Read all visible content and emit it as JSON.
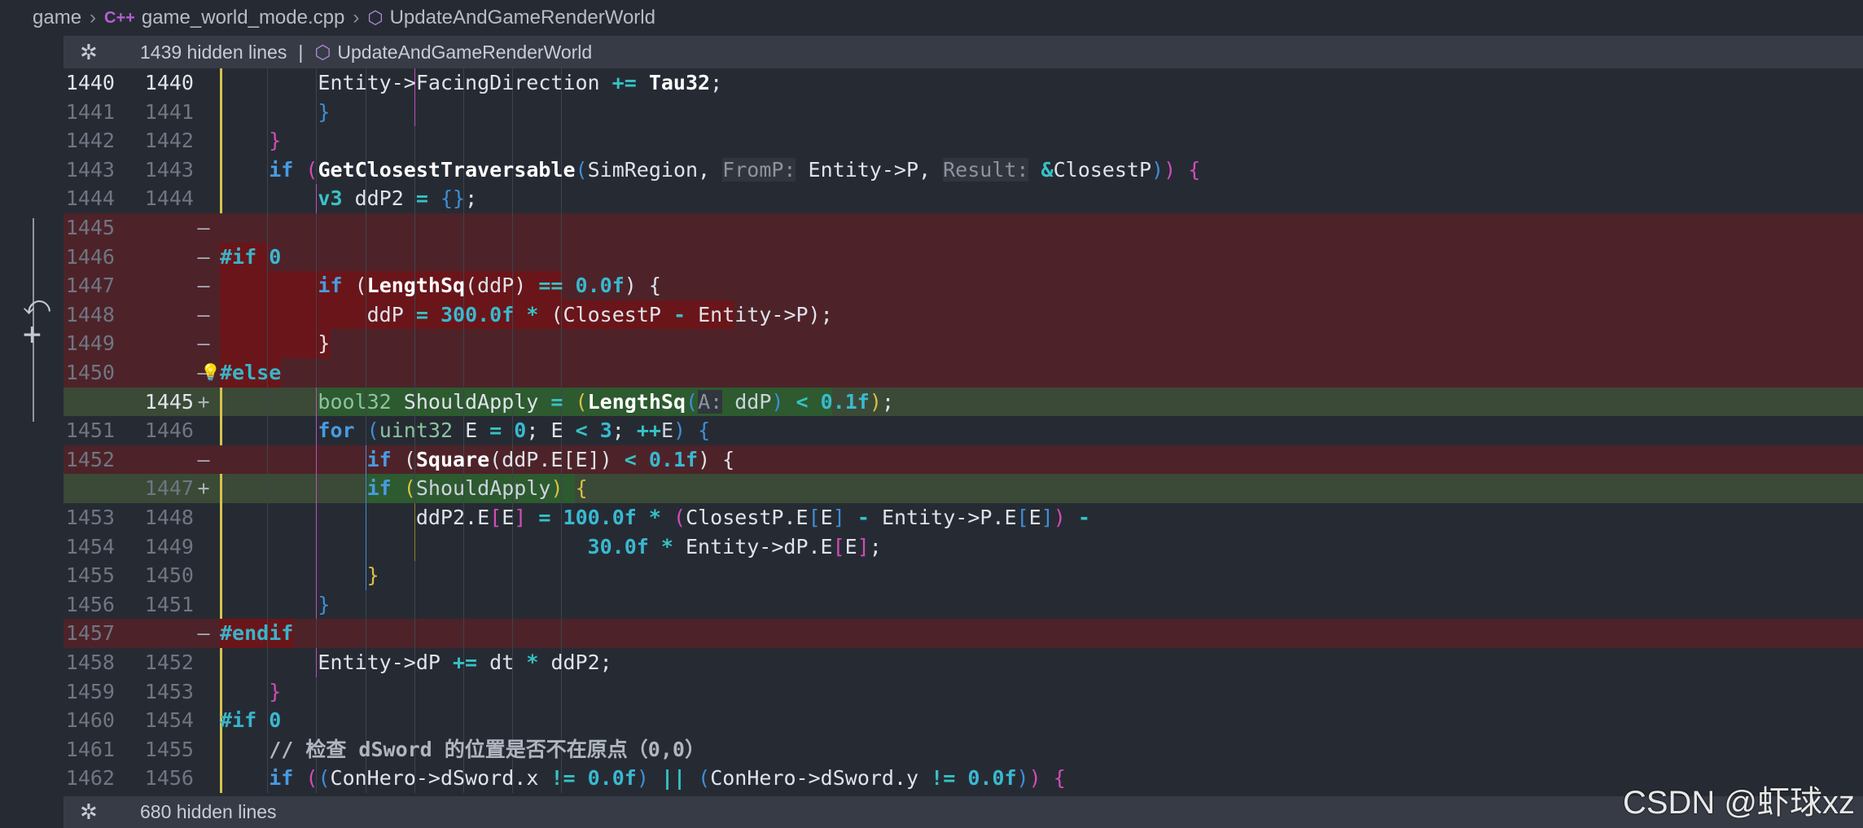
{
  "breadcrumb": {
    "root": "game",
    "file_icon": "C++",
    "file": "game_world_mode.cpp",
    "symbol": "UpdateAndGameRenderWorld"
  },
  "top_fold": {
    "hidden": "1439 hidden lines",
    "separator": "|",
    "symbol": "UpdateAndGameRenderWorld"
  },
  "bottom_fold": {
    "hidden": "680 hidden lines"
  },
  "watermark": "CSDN @虾球xz",
  "colors": {
    "deleted_bg": "#4d2329",
    "deleted_highlight": "#6a1519",
    "inserted_bg": "#3a4a36",
    "inserted_highlight": "#2d5a2f",
    "modified_gutter": "#d7c34a"
  },
  "lines": [
    {
      "old": "1440",
      "new": "1440",
      "type": "ctx",
      "current": true,
      "guides": [
        {
          "c": 2,
          "k": "m"
        },
        {
          "c": 3,
          "k": "g"
        }
      ],
      "tokens": [
        [
          "        ",
          ""
        ],
        [
          "Entity->FacingDirection ",
          "txt"
        ],
        [
          "+=",
          "op"
        ],
        [
          " ",
          ""
        ],
        [
          "Tau32",
          "fn"
        ],
        [
          ";",
          "txt"
        ]
      ]
    },
    {
      "old": "1441",
      "new": "1441",
      "type": "ctx",
      "guides": [
        {
          "c": 2,
          "k": "m"
        }
      ],
      "tokens": [
        [
          "        ",
          ""
        ],
        [
          "}",
          "p2"
        ]
      ]
    },
    {
      "old": "1442",
      "new": "1442",
      "type": "ctx",
      "guides": [],
      "tokens": [
        [
          "    ",
          ""
        ],
        [
          "}",
          "p1"
        ]
      ]
    },
    {
      "old": "1443",
      "new": "1443",
      "type": "ctx",
      "guides": [],
      "tokens": [
        [
          "    ",
          ""
        ],
        [
          "if",
          "kw"
        ],
        [
          " ",
          ""
        ],
        [
          "(",
          "p1"
        ],
        [
          "GetClosestTraversable",
          "fn"
        ],
        [
          "(",
          "p2"
        ],
        [
          "SimRegion, ",
          "txt"
        ],
        [
          "FromP:",
          "hint"
        ],
        [
          " Entity->P, ",
          "txt"
        ],
        [
          "Result:",
          "hint"
        ],
        [
          " ",
          ""
        ],
        [
          "&",
          "op"
        ],
        [
          "ClosestP",
          "txt"
        ],
        [
          ")",
          "p2"
        ],
        [
          ")",
          "p1"
        ],
        [
          " ",
          ""
        ],
        [
          "{",
          "p1"
        ]
      ]
    },
    {
      "old": "1444",
      "new": "1444",
      "type": "ctx",
      "guides": [
        {
          "c": 0,
          "k": "m"
        }
      ],
      "tokens": [
        [
          "        ",
          ""
        ],
        [
          "v3",
          "kt"
        ],
        [
          " ddP2 ",
          "txt"
        ],
        [
          "=",
          "op"
        ],
        [
          " ",
          ""
        ],
        [
          "{}",
          "p2"
        ],
        [
          ";",
          "txt"
        ]
      ]
    },
    {
      "old": "1445",
      "new": "",
      "type": "del",
      "marker": "—",
      "hl": [
        0,
        0
      ],
      "guides": [],
      "tokens": []
    },
    {
      "old": "1446",
      "new": "",
      "type": "del",
      "marker": "—",
      "hl": [
        0,
        4
      ],
      "guides": [],
      "tokens": [
        [
          "#if",
          "pp"
        ],
        [
          " ",
          ""
        ],
        [
          "0",
          "num"
        ]
      ]
    },
    {
      "old": "1447",
      "new": "",
      "type": "del",
      "marker": "—",
      "hl": [
        0,
        28
      ],
      "guides": [],
      "tokens": [
        [
          "        ",
          ""
        ],
        [
          "if",
          "kw"
        ],
        [
          " (",
          "txt"
        ],
        [
          "LengthSq",
          "fn"
        ],
        [
          "(ddP) ",
          "txt"
        ],
        [
          "==",
          "op"
        ],
        [
          " ",
          ""
        ],
        [
          "0.0f",
          "num"
        ],
        [
          ") {",
          "txt"
        ]
      ]
    },
    {
      "old": "1448",
      "new": "",
      "type": "del",
      "marker": "—",
      "hl": [
        0,
        42
      ],
      "guides": [],
      "tokens": [
        [
          "            ",
          ""
        ],
        [
          "ddP ",
          "txt"
        ],
        [
          "=",
          "op"
        ],
        [
          " ",
          ""
        ],
        [
          "300.0f",
          "num"
        ],
        [
          " ",
          ""
        ],
        [
          "*",
          "op"
        ],
        [
          " (ClosestP ",
          "txt"
        ],
        [
          "-",
          "op"
        ],
        [
          " Entity->P);",
          "txt"
        ]
      ]
    },
    {
      "old": "1449",
      "new": "",
      "type": "del",
      "marker": "—",
      "hl": [
        0,
        9
      ],
      "guides": [],
      "tokens": [
        [
          "        ",
          ""
        ],
        [
          "}",
          "txt"
        ]
      ]
    },
    {
      "old": "1450",
      "new": "",
      "type": "del",
      "marker": "—",
      "bulb": true,
      "hl": [
        0,
        5
      ],
      "guides": [],
      "tokens": [
        [
          "#else",
          "pp"
        ]
      ]
    },
    {
      "old": "",
      "new": "1445",
      "type": "ins",
      "current_new": true,
      "marker": "+",
      "hl": [
        8,
        50
      ],
      "guides": [
        {
          "c": 0,
          "k": "m"
        }
      ],
      "tokens": [
        [
          "        ",
          ""
        ],
        [
          "bool32",
          "ty2"
        ],
        [
          " ShouldApply ",
          "txt"
        ],
        [
          "=",
          "op"
        ],
        [
          " ",
          ""
        ],
        [
          "(",
          "p3"
        ],
        [
          "LengthSq",
          "fn"
        ],
        [
          "(",
          "p2"
        ],
        [
          "A:",
          "hint"
        ],
        [
          " ddP",
          ""
        ],
        [
          ")",
          "p2"
        ],
        [
          " ",
          ""
        ],
        [
          "<",
          "op"
        ],
        [
          " ",
          ""
        ],
        [
          "0.1f",
          "num"
        ],
        [
          ")",
          "p3"
        ],
        [
          ";",
          "txt"
        ]
      ]
    },
    {
      "old": "1451",
      "new": "1446",
      "type": "ctx",
      "guides": [
        {
          "c": 0,
          "k": "m"
        }
      ],
      "tokens": [
        [
          "        ",
          ""
        ],
        [
          "for",
          "kw"
        ],
        [
          " ",
          ""
        ],
        [
          "(",
          "p2"
        ],
        [
          "uint32",
          "ty2"
        ],
        [
          " E ",
          "txt"
        ],
        [
          "=",
          "op"
        ],
        [
          " ",
          ""
        ],
        [
          "0",
          "num"
        ],
        [
          "; E ",
          "txt"
        ],
        [
          "<",
          "op"
        ],
        [
          " ",
          ""
        ],
        [
          "3",
          "num"
        ],
        [
          "; ",
          "txt"
        ],
        [
          "++",
          "op"
        ],
        [
          "E",
          ""
        ],
        [
          ")",
          "p2"
        ],
        [
          " ",
          ""
        ],
        [
          "{",
          "p2"
        ]
      ]
    },
    {
      "old": "1452",
      "new": "",
      "type": "del",
      "marker": "—",
      "hl": [
        0,
        0
      ],
      "guides": [
        {
          "c": 0,
          "k": "m"
        },
        {
          "c": 1,
          "k": "b"
        }
      ],
      "tokens": [
        [
          "            ",
          ""
        ],
        [
          "if",
          "kw"
        ],
        [
          " (",
          "txt"
        ],
        [
          "Square",
          "fn"
        ],
        [
          "(ddP.E[E]) ",
          "txt"
        ],
        [
          "<",
          "op"
        ],
        [
          " ",
          ""
        ],
        [
          "0.1f",
          "num"
        ],
        [
          ") {",
          "txt"
        ]
      ]
    },
    {
      "old": "",
      "new": "1447",
      "type": "ins",
      "marker": "+",
      "hl": [
        12,
        29
      ],
      "guides": [
        {
          "c": 0,
          "k": "m"
        },
        {
          "c": 1,
          "k": "b"
        }
      ],
      "tokens": [
        [
          "            ",
          ""
        ],
        [
          "if",
          "kw"
        ],
        [
          " ",
          ""
        ],
        [
          "(",
          "p3"
        ],
        [
          "ShouldApply",
          ""
        ],
        [
          ")",
          "p3"
        ],
        [
          " ",
          ""
        ],
        [
          "{",
          "p3"
        ]
      ]
    },
    {
      "old": "1453",
      "new": "1448",
      "type": "ctx",
      "guides": [
        {
          "c": 0,
          "k": "m"
        },
        {
          "c": 1,
          "k": "b"
        },
        {
          "c": 2,
          "k": "y"
        }
      ],
      "tokens": [
        [
          "                ",
          ""
        ],
        [
          "ddP2.E",
          "txt"
        ],
        [
          "[",
          "p1"
        ],
        [
          "E",
          "txt"
        ],
        [
          "]",
          "p1"
        ],
        [
          " ",
          ""
        ],
        [
          "=",
          "op"
        ],
        [
          " ",
          ""
        ],
        [
          "100.0f",
          "num"
        ],
        [
          " ",
          ""
        ],
        [
          "*",
          "op"
        ],
        [
          " ",
          ""
        ],
        [
          "(",
          "p1"
        ],
        [
          "ClosestP.E",
          "txt"
        ],
        [
          "[",
          "p2"
        ],
        [
          "E",
          "txt"
        ],
        [
          "]",
          "p2"
        ],
        [
          " ",
          ""
        ],
        [
          "-",
          "op"
        ],
        [
          " Entity->P.E",
          "txt"
        ],
        [
          "[",
          "p2"
        ],
        [
          "E",
          "txt"
        ],
        [
          "]",
          "p2"
        ],
        [
          ")",
          "p1"
        ],
        [
          " ",
          ""
        ],
        [
          "-",
          "op"
        ]
      ]
    },
    {
      "old": "1454",
      "new": "1449",
      "type": "ctx",
      "guides": [
        {
          "c": 0,
          "k": "m"
        },
        {
          "c": 1,
          "k": "b"
        },
        {
          "c": 2,
          "k": "y"
        },
        {
          "c": 3,
          "k": "g"
        },
        {
          "c": 4,
          "k": "g"
        },
        {
          "c": 5,
          "k": "g"
        }
      ],
      "tokens": [
        [
          "                              ",
          ""
        ],
        [
          "30.0f",
          "num"
        ],
        [
          " ",
          ""
        ],
        [
          "*",
          "op"
        ],
        [
          " Entity->dP.E",
          "txt"
        ],
        [
          "[",
          "p1"
        ],
        [
          "E",
          "txt"
        ],
        [
          "]",
          "p1"
        ],
        [
          ";",
          "txt"
        ]
      ]
    },
    {
      "old": "1455",
      "new": "1450",
      "type": "ctx",
      "guides": [
        {
          "c": 0,
          "k": "m"
        },
        {
          "c": 1,
          "k": "b"
        }
      ],
      "tokens": [
        [
          "            ",
          ""
        ],
        [
          "}",
          "p3"
        ]
      ]
    },
    {
      "old": "1456",
      "new": "1451",
      "type": "ctx",
      "guides": [
        {
          "c": 0,
          "k": "m"
        }
      ],
      "tokens": [
        [
          "        ",
          ""
        ],
        [
          "}",
          "p2"
        ]
      ]
    },
    {
      "old": "1457",
      "new": "",
      "type": "del",
      "marker": "—",
      "hl": [
        0,
        6
      ],
      "guides": [],
      "tokens": [
        [
          "#endif",
          "pp"
        ]
      ]
    },
    {
      "old": "1458",
      "new": "1452",
      "type": "ctx",
      "guides": [
        {
          "c": 0,
          "k": "m"
        }
      ],
      "tokens": [
        [
          "        ",
          ""
        ],
        [
          "Entity->dP ",
          "txt"
        ],
        [
          "+=",
          "op"
        ],
        [
          " dt ",
          "txt"
        ],
        [
          "*",
          "op"
        ],
        [
          " ddP2;",
          "txt"
        ]
      ]
    },
    {
      "old": "1459",
      "new": "1453",
      "type": "ctx",
      "guides": [],
      "tokens": [
        [
          "    ",
          ""
        ],
        [
          "}",
          "p1"
        ]
      ]
    },
    {
      "old": "1460",
      "new": "1454",
      "type": "ctx",
      "guides": [],
      "tokens": [
        [
          "#if",
          "pp"
        ],
        [
          " ",
          ""
        ],
        [
          "0",
          "num"
        ]
      ]
    },
    {
      "old": "1461",
      "new": "1455",
      "type": "ctx",
      "guides": [],
      "tokens": [
        [
          "    ",
          ""
        ],
        [
          "// 检查 dSword 的位置是否不在原点（0,0）",
          "cm"
        ]
      ]
    },
    {
      "old": "1462",
      "new": "1456",
      "type": "ctx",
      "guides": [],
      "tokens": [
        [
          "    ",
          ""
        ],
        [
          "if",
          "kw"
        ],
        [
          " ",
          ""
        ],
        [
          "(",
          "p1"
        ],
        [
          "(",
          "p2"
        ],
        [
          "ConHero->dSword.x ",
          "txt"
        ],
        [
          "!=",
          "op"
        ],
        [
          " ",
          ""
        ],
        [
          "0.0f",
          "num"
        ],
        [
          ")",
          "p2"
        ],
        [
          " ",
          ""
        ],
        [
          "||",
          "op"
        ],
        [
          " ",
          ""
        ],
        [
          "(",
          "p2"
        ],
        [
          "ConHero->dSword.y ",
          "txt"
        ],
        [
          "!=",
          "op"
        ],
        [
          " ",
          ""
        ],
        [
          "0.0f",
          "num"
        ],
        [
          ")",
          "p2"
        ],
        [
          ")",
          "p1"
        ],
        [
          " ",
          ""
        ],
        [
          "{",
          "p1"
        ]
      ]
    }
  ]
}
